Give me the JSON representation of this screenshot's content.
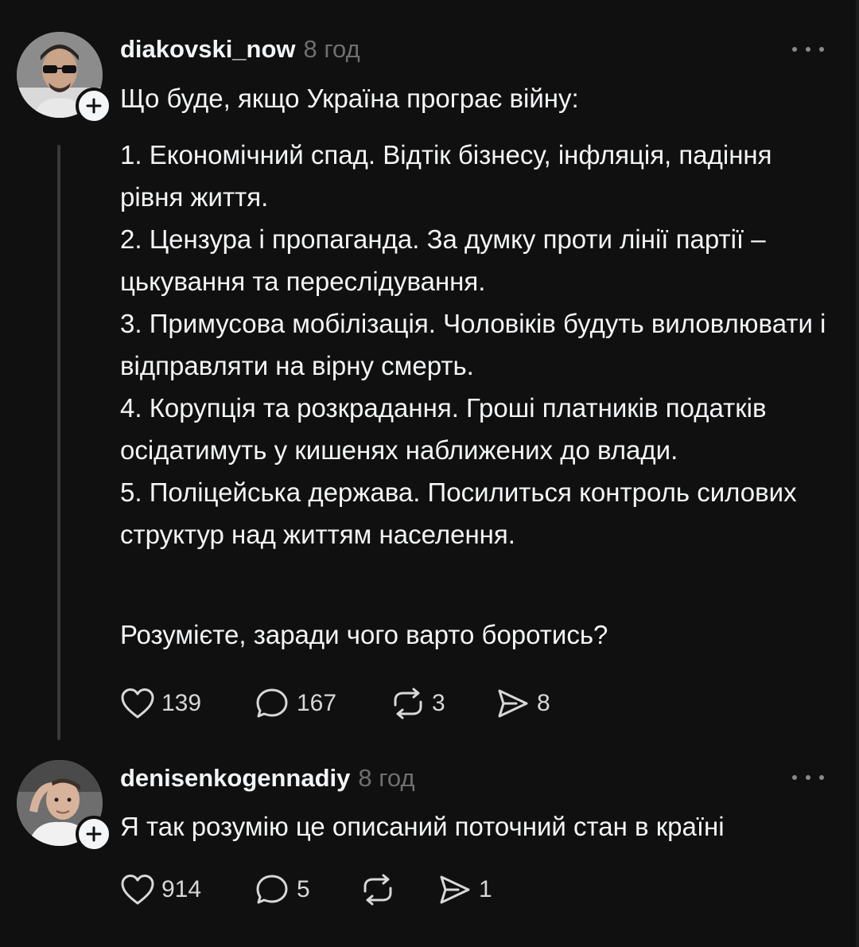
{
  "posts": [
    {
      "username": "diakovski_now",
      "time": "8 год",
      "intro": "Що буде, якщо Україна програє війну:",
      "body": "1. Економічний спад. Відтік бізнесу, інфляція, падіння рівня життя.\n2. Цензура і пропаганда. За думку проти лінії партії – цькування та переслідування.\n3. Примусова мобілізація. Чоловіків будуть виловлювати і відправляти на вірну смерть.\n4. Корупція та розкрадання. Гроші платників податків осідатимуть у кишенях наближених до влади.\n5. Поліцейська держава. Посилиться контроль силових структур над життям населення.",
      "closing": "Розумієте, заради чого варто боротись?",
      "likes": "139",
      "replies": "167",
      "reposts": "3",
      "shares": "8"
    },
    {
      "username": "denisenkogennadiy",
      "time": "8 год",
      "intro": "Я так розумію це описаний поточний стан в країні",
      "likes": "914",
      "replies": "5",
      "reposts": "",
      "shares": "1"
    }
  ],
  "icons": {
    "like": "heart-icon",
    "reply": "speech-bubble-icon",
    "repost": "repost-arrows-icon",
    "share": "send-icon",
    "more": "more-dots-icon",
    "follow": "plus-icon"
  },
  "colors": {
    "background": "#101010",
    "text": "#f3f5f7",
    "secondary": "#6f6f6f",
    "thread_line": "#3a3a3a"
  }
}
